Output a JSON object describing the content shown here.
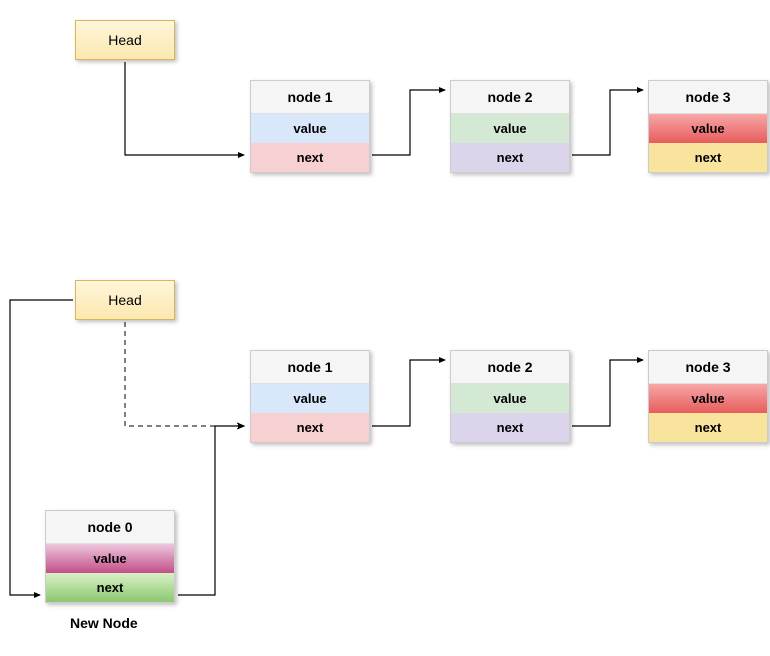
{
  "top": {
    "head": "Head",
    "nodes": [
      {
        "title": "node 1",
        "f1": "value",
        "f2": "next",
        "c1": "#d9e7fb",
        "c2": "#f7d1d1"
      },
      {
        "title": "node 2",
        "f1": "value",
        "f2": "next",
        "c1": "#d4e9d4",
        "c2": "#dcd4ea"
      },
      {
        "title": "node 3",
        "f1": "value",
        "f2": "next",
        "c1": "linear-gradient(#f7a7a7,#e85c5c)",
        "c2": "#f9e49e"
      }
    ]
  },
  "bottom": {
    "head": "Head",
    "nodes": [
      {
        "title": "node 1",
        "f1": "value",
        "f2": "next",
        "c1": "#d9e7fb",
        "c2": "#f7d1d1"
      },
      {
        "title": "node 2",
        "f1": "value",
        "f2": "next",
        "c1": "#d4e9d4",
        "c2": "#dcd4ea"
      },
      {
        "title": "node 3",
        "f1": "value",
        "f2": "next",
        "c1": "linear-gradient(#f7a7a7,#e85c5c)",
        "c2": "#f9e49e"
      }
    ],
    "newNode": {
      "title": "node 0",
      "f1": "value",
      "f2": "next",
      "c1": "linear-gradient(#eec7dc,#c24f89)",
      "c2": "linear-gradient(#d9f0c7,#8bc86f)"
    },
    "caption": "New Node"
  }
}
